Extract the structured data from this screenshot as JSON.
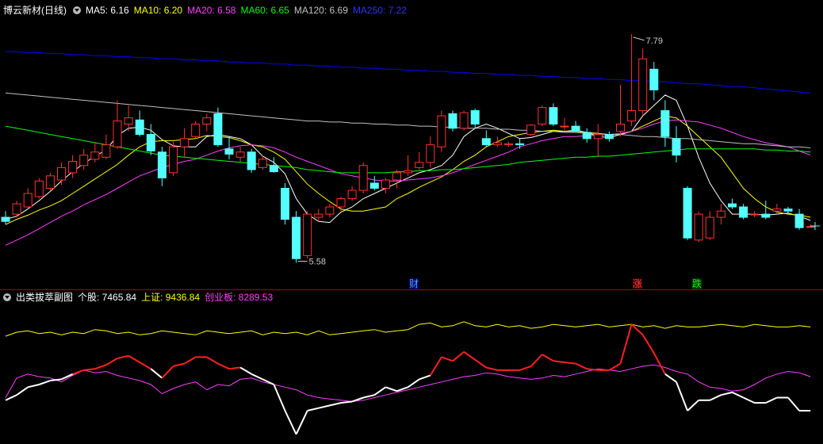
{
  "header": {
    "stock_name": "博云新材(日线)",
    "ma5": {
      "label": "MA5: 6.16",
      "color": "#ffffff"
    },
    "ma10": {
      "label": "MA10: 6.20",
      "color": "#ffff00"
    },
    "ma20": {
      "label": "MA20: 6.58",
      "color": "#ff40ff"
    },
    "ma60": {
      "label": "MA60: 6.65",
      "color": "#00ff00"
    },
    "ma120": {
      "label": "MA120: 6.69",
      "color": "#c0c0c0"
    },
    "ma250": {
      "label": "MA250: 7.22",
      "color": "#0000ff"
    }
  },
  "annotations": {
    "high": "7.79",
    "low": "5.58"
  },
  "events": [
    {
      "label": "财",
      "color": "#4da6ff",
      "bg": "#000060"
    },
    {
      "label": "涨",
      "color": "#ff4040",
      "bg": "#400000"
    },
    {
      "label": "跌",
      "color": "#00ff00",
      "bg": "#003000"
    }
  ],
  "sub_header": {
    "title": "出类拔萃副图",
    "stock": "个股: 7465.84",
    "sh": "上证: 9436.84",
    "cyb": "创业板: 8289.53",
    "color_stock": "#ffffff",
    "color_sh": "#ffff00",
    "color_cyb": "#ff40ff"
  },
  "chart_data": {
    "type": "candlestick",
    "title": "博云新材(日线)",
    "ylim": [
      5.4,
      7.95
    ],
    "up_color": "#ff3232",
    "down_color": "#54ffff",
    "candles": [
      [
        6.02,
        6.08,
        5.95,
        5.98
      ],
      [
        6.05,
        6.18,
        6.02,
        6.15
      ],
      [
        6.12,
        6.3,
        6.1,
        6.25
      ],
      [
        6.22,
        6.4,
        6.2,
        6.37
      ],
      [
        6.3,
        6.45,
        6.28,
        6.42
      ],
      [
        6.38,
        6.55,
        6.33,
        6.5
      ],
      [
        6.45,
        6.62,
        6.4,
        6.56
      ],
      [
        6.52,
        6.68,
        6.48,
        6.62
      ],
      [
        6.58,
        6.75,
        6.55,
        6.65
      ],
      [
        6.6,
        6.82,
        6.58,
        6.72
      ],
      [
        6.7,
        7.15,
        6.68,
        6.95
      ],
      [
        6.92,
        7.1,
        6.85,
        6.98
      ],
      [
        6.96,
        7.05,
        6.8,
        6.82
      ],
      [
        6.82,
        6.92,
        6.62,
        6.66
      ],
      [
        6.65,
        6.7,
        6.32,
        6.4
      ],
      [
        6.45,
        6.75,
        6.42,
        6.7
      ],
      [
        6.7,
        6.88,
        6.6,
        6.78
      ],
      [
        6.8,
        6.95,
        6.78,
        6.92
      ],
      [
        6.92,
        7.02,
        6.85,
        6.98
      ],
      [
        7.02,
        7.08,
        6.7,
        6.72
      ],
      [
        6.68,
        6.8,
        6.58,
        6.63
      ],
      [
        6.6,
        6.7,
        6.55,
        6.65
      ],
      [
        6.65,
        6.68,
        6.45,
        6.48
      ],
      [
        6.5,
        6.62,
        6.48,
        6.58
      ],
      [
        6.52,
        6.6,
        6.45,
        6.46
      ],
      [
        6.3,
        6.35,
        5.95,
        6.0
      ],
      [
        6.02,
        6.08,
        5.58,
        5.62
      ],
      [
        5.65,
        6.08,
        5.62,
        6.05
      ],
      [
        6.02,
        6.1,
        5.98,
        6.05
      ],
      [
        6.05,
        6.15,
        6.02,
        6.12
      ],
      [
        6.12,
        6.22,
        6.08,
        6.2
      ],
      [
        6.2,
        6.32,
        6.18,
        6.28
      ],
      [
        6.28,
        6.55,
        6.25,
        6.52
      ],
      [
        6.35,
        6.42,
        6.28,
        6.3
      ],
      [
        6.3,
        6.4,
        6.25,
        6.38
      ],
      [
        6.38,
        6.48,
        6.3,
        6.45
      ],
      [
        6.45,
        6.62,
        6.42,
        6.47
      ],
      [
        6.5,
        6.65,
        6.48,
        6.55
      ],
      [
        6.55,
        6.8,
        6.5,
        6.72
      ],
      [
        6.7,
        7.05,
        6.65,
        7.0
      ],
      [
        7.02,
        7.05,
        6.85,
        6.88
      ],
      [
        6.88,
        7.05,
        6.86,
        7.03
      ],
      [
        7.05,
        7.07,
        6.88,
        6.92
      ],
      [
        6.78,
        6.86,
        6.7,
        6.72
      ],
      [
        6.72,
        6.8,
        6.7,
        6.74
      ],
      [
        6.72,
        6.75,
        6.7,
        6.73
      ],
      [
        6.73,
        6.78,
        6.68,
        6.72
      ],
      [
        6.82,
        6.92,
        6.8,
        6.91
      ],
      [
        6.92,
        7.1,
        6.9,
        7.08
      ],
      [
        7.08,
        7.12,
        6.9,
        6.92
      ],
      [
        6.9,
        6.98,
        6.86,
        6.9
      ],
      [
        6.9,
        6.95,
        6.85,
        6.85
      ],
      [
        6.84,
        6.88,
        6.74,
        6.78
      ],
      [
        6.78,
        6.92,
        6.6,
        6.82
      ],
      [
        6.82,
        6.85,
        6.75,
        6.78
      ],
      [
        6.85,
        7.3,
        6.8,
        6.92
      ],
      [
        6.95,
        7.79,
        6.9,
        7.05
      ],
      [
        7.05,
        7.65,
        7.0,
        7.55
      ],
      [
        7.45,
        7.52,
        7.15,
        7.25
      ],
      [
        7.05,
        7.15,
        6.7,
        6.8
      ],
      [
        6.78,
        6.9,
        6.55,
        6.62
      ],
      [
        6.3,
        6.32,
        5.8,
        5.82
      ],
      [
        5.8,
        6.08,
        5.78,
        6.05
      ],
      [
        5.82,
        6.08,
        5.8,
        6.02
      ],
      [
        6.02,
        6.15,
        5.95,
        6.08
      ],
      [
        6.15,
        6.2,
        6.1,
        6.12
      ],
      [
        6.12,
        6.15,
        6.0,
        6.02
      ],
      [
        6.05,
        6.08,
        6.02,
        6.05
      ],
      [
        6.05,
        6.18,
        6.0,
        6.02
      ],
      [
        6.08,
        6.15,
        6.05,
        6.1
      ],
      [
        6.1,
        6.12,
        6.05,
        6.08
      ],
      [
        6.05,
        6.1,
        5.9,
        5.92
      ],
      [
        5.93,
        5.95,
        5.92,
        5.93
      ]
    ],
    "series": [
      {
        "name": "MA5",
        "color": "#ffffff",
        "values": [
          6.0,
          6.03,
          6.1,
          6.18,
          6.27,
          6.37,
          6.46,
          6.54,
          6.61,
          6.67,
          6.81,
          6.88,
          6.89,
          6.86,
          6.77,
          6.71,
          6.7,
          6.7,
          6.8,
          6.82,
          6.8,
          6.78,
          6.72,
          6.61,
          6.55,
          6.44,
          6.2,
          6.05,
          5.98,
          5.97,
          6.07,
          6.12,
          6.2,
          6.25,
          6.3,
          6.35,
          6.4,
          6.45,
          6.48,
          6.52,
          6.62,
          6.8,
          6.88,
          6.92,
          6.88,
          6.83,
          6.78,
          6.79,
          6.82,
          6.85,
          6.85,
          6.86,
          6.84,
          6.8,
          6.79,
          6.82,
          6.85,
          7.0,
          7.1,
          7.2,
          7.15,
          6.9,
          6.6,
          6.35,
          6.18,
          6.05,
          6.05,
          6.05,
          6.04,
          6.05,
          6.06,
          6.03,
          5.99
        ]
      },
      {
        "name": "MA10",
        "color": "#ffff00",
        "values": [
          5.95,
          6.0,
          6.04,
          6.09,
          6.13,
          6.18,
          6.25,
          6.32,
          6.39,
          6.46,
          6.53,
          6.62,
          6.7,
          6.75,
          6.76,
          6.76,
          6.77,
          6.78,
          6.81,
          6.8,
          6.79,
          6.76,
          6.72,
          6.7,
          6.65,
          6.58,
          6.46,
          6.34,
          6.25,
          6.17,
          6.1,
          6.08,
          6.08,
          6.1,
          6.12,
          6.2,
          6.25,
          6.31,
          6.36,
          6.41,
          6.48,
          6.56,
          6.62,
          6.7,
          6.75,
          6.8,
          6.82,
          6.84,
          6.85,
          6.86,
          6.85,
          6.85,
          6.84,
          6.83,
          6.82,
          6.82,
          6.85,
          6.9,
          6.95,
          7.0,
          6.98,
          6.9,
          6.8,
          6.7,
          6.6,
          6.45,
          6.3,
          6.2,
          6.12,
          6.07,
          6.05,
          6.04,
          6.02
        ]
      },
      {
        "name": "MA20",
        "color": "#ff40ff",
        "values": [
          5.75,
          5.8,
          5.85,
          5.91,
          5.97,
          6.03,
          6.08,
          6.14,
          6.19,
          6.24,
          6.3,
          6.36,
          6.42,
          6.46,
          6.5,
          6.53,
          6.56,
          6.58,
          6.62,
          6.66,
          6.69,
          6.71,
          6.72,
          6.71,
          6.69,
          6.65,
          6.6,
          6.56,
          6.52,
          6.48,
          6.44,
          6.42,
          6.4,
          6.38,
          6.37,
          6.37,
          6.38,
          6.39,
          6.4,
          6.42,
          6.45,
          6.49,
          6.53,
          6.57,
          6.61,
          6.65,
          6.7,
          6.73,
          6.76,
          6.78,
          6.8,
          6.8,
          6.81,
          6.81,
          6.82,
          6.83,
          6.85,
          6.88,
          6.92,
          6.95,
          6.96,
          6.95,
          6.94,
          6.91,
          6.88,
          6.84,
          6.8,
          6.77,
          6.74,
          6.72,
          6.7,
          6.66,
          6.62
        ]
      },
      {
        "name": "MA60",
        "color": "#00ff00",
        "values": [
          6.9,
          6.88,
          6.86,
          6.84,
          6.82,
          6.8,
          6.78,
          6.76,
          6.74,
          6.72,
          6.7,
          6.68,
          6.66,
          6.64,
          6.62,
          6.61,
          6.6,
          6.59,
          6.58,
          6.57,
          6.56,
          6.55,
          6.54,
          6.53,
          6.52,
          6.51,
          6.5,
          6.48,
          6.47,
          6.46,
          6.45,
          6.45,
          6.45,
          6.45,
          6.45,
          6.46,
          6.46,
          6.47,
          6.47,
          6.48,
          6.48,
          6.49,
          6.5,
          6.51,
          6.52,
          6.53,
          6.55,
          6.56,
          6.57,
          6.58,
          6.59,
          6.6,
          6.6,
          6.61,
          6.61,
          6.62,
          6.63,
          6.64,
          6.65,
          6.66,
          6.67,
          6.68,
          6.68,
          6.68,
          6.68,
          6.68,
          6.68,
          6.68,
          6.67,
          6.67,
          6.66,
          6.66,
          6.65
        ]
      },
      {
        "name": "MA120",
        "color": "#c0c0c0",
        "values": [
          7.22,
          7.21,
          7.2,
          7.19,
          7.18,
          7.17,
          7.16,
          7.15,
          7.14,
          7.13,
          7.12,
          7.11,
          7.1,
          7.09,
          7.08,
          7.07,
          7.06,
          7.05,
          7.04,
          7.03,
          7.02,
          7.01,
          7.0,
          6.99,
          6.98,
          6.97,
          6.96,
          6.95,
          6.95,
          6.94,
          6.94,
          6.93,
          6.93,
          6.92,
          6.92,
          6.91,
          6.91,
          6.9,
          6.9,
          6.89,
          6.89,
          6.88,
          6.88,
          6.88,
          6.87,
          6.87,
          6.86,
          6.86,
          6.85,
          6.85,
          6.84,
          6.84,
          6.83,
          6.83,
          6.82,
          6.82,
          6.81,
          6.8,
          6.8,
          6.79,
          6.78,
          6.78,
          6.77,
          6.76,
          6.75,
          6.74,
          6.73,
          6.73,
          6.72,
          6.71,
          6.7,
          6.7,
          6.69
        ]
      },
      {
        "name": "MA250",
        "color": "#0000ff",
        "values": [
          7.62,
          7.62,
          7.61,
          7.61,
          7.6,
          7.6,
          7.59,
          7.59,
          7.58,
          7.58,
          7.57,
          7.57,
          7.56,
          7.56,
          7.55,
          7.55,
          7.54,
          7.54,
          7.53,
          7.53,
          7.52,
          7.52,
          7.51,
          7.51,
          7.5,
          7.5,
          7.49,
          7.49,
          7.48,
          7.48,
          7.47,
          7.47,
          7.46,
          7.46,
          7.45,
          7.45,
          7.44,
          7.44,
          7.43,
          7.43,
          7.42,
          7.42,
          7.41,
          7.41,
          7.4,
          7.4,
          7.39,
          7.39,
          7.38,
          7.38,
          7.37,
          7.37,
          7.36,
          7.36,
          7.35,
          7.35,
          7.34,
          7.34,
          7.33,
          7.33,
          7.32,
          7.31,
          7.31,
          7.3,
          7.29,
          7.28,
          7.28,
          7.27,
          7.26,
          7.25,
          7.24,
          7.23,
          7.22
        ]
      }
    ],
    "sub_chart": {
      "type": "line",
      "ylim": [
        0,
        100
      ],
      "series": [
        {
          "name": "上证",
          "color": "#ffff00",
          "values": [
            77,
            80,
            81,
            79,
            80,
            78,
            80,
            79,
            82,
            81,
            79,
            80,
            78,
            79,
            81,
            80,
            79,
            78,
            81,
            80,
            79,
            80,
            81,
            78,
            80,
            79,
            80,
            78,
            81,
            78,
            79,
            80,
            81,
            82,
            80,
            81,
            82,
            86,
            87,
            84,
            85,
            88,
            85,
            84,
            86,
            84,
            85,
            83,
            84,
            86,
            85,
            84,
            85,
            86,
            84,
            85,
            86,
            84,
            85,
            83,
            85,
            84,
            84,
            85,
            86,
            85,
            84,
            86,
            85,
            84,
            84,
            85,
            84
          ]
        },
        {
          "name": "创业板",
          "color": "#ff40ff",
          "values": [
            30,
            45,
            48,
            46,
            45,
            42,
            47,
            51,
            49,
            50,
            47,
            45,
            43,
            40,
            33,
            37,
            40,
            42,
            36,
            40,
            39,
            44,
            45,
            42,
            40,
            38,
            36,
            32,
            30,
            29,
            28,
            27,
            28,
            30,
            32,
            34,
            36,
            38,
            40,
            42,
            44,
            46,
            47,
            49,
            48,
            46,
            45,
            44,
            45,
            47,
            46,
            48,
            50,
            52,
            51,
            50,
            52,
            54,
            55,
            53,
            50,
            48,
            42,
            38,
            37,
            35,
            36,
            40,
            45,
            48,
            50,
            49,
            46
          ]
        },
        {
          "name": "个股",
          "color": "#ffffff",
          "values": [
            28,
            32,
            38,
            40,
            43,
            44,
            48,
            51,
            52,
            55,
            60,
            62,
            57,
            52,
            45,
            54,
            56,
            61,
            61,
            56,
            52,
            53,
            48,
            44,
            40,
            20,
            2,
            20,
            22,
            24,
            26,
            27,
            30,
            32,
            38,
            35,
            38,
            44,
            47,
            61,
            58,
            65,
            59,
            53,
            51,
            51,
            51,
            54,
            63,
            58,
            57,
            56,
            52,
            51,
            51,
            56,
            86,
            78,
            64,
            48,
            42,
            20,
            28,
            28,
            32,
            34,
            30,
            26,
            26,
            30,
            30,
            20,
            20
          ]
        }
      ]
    }
  }
}
